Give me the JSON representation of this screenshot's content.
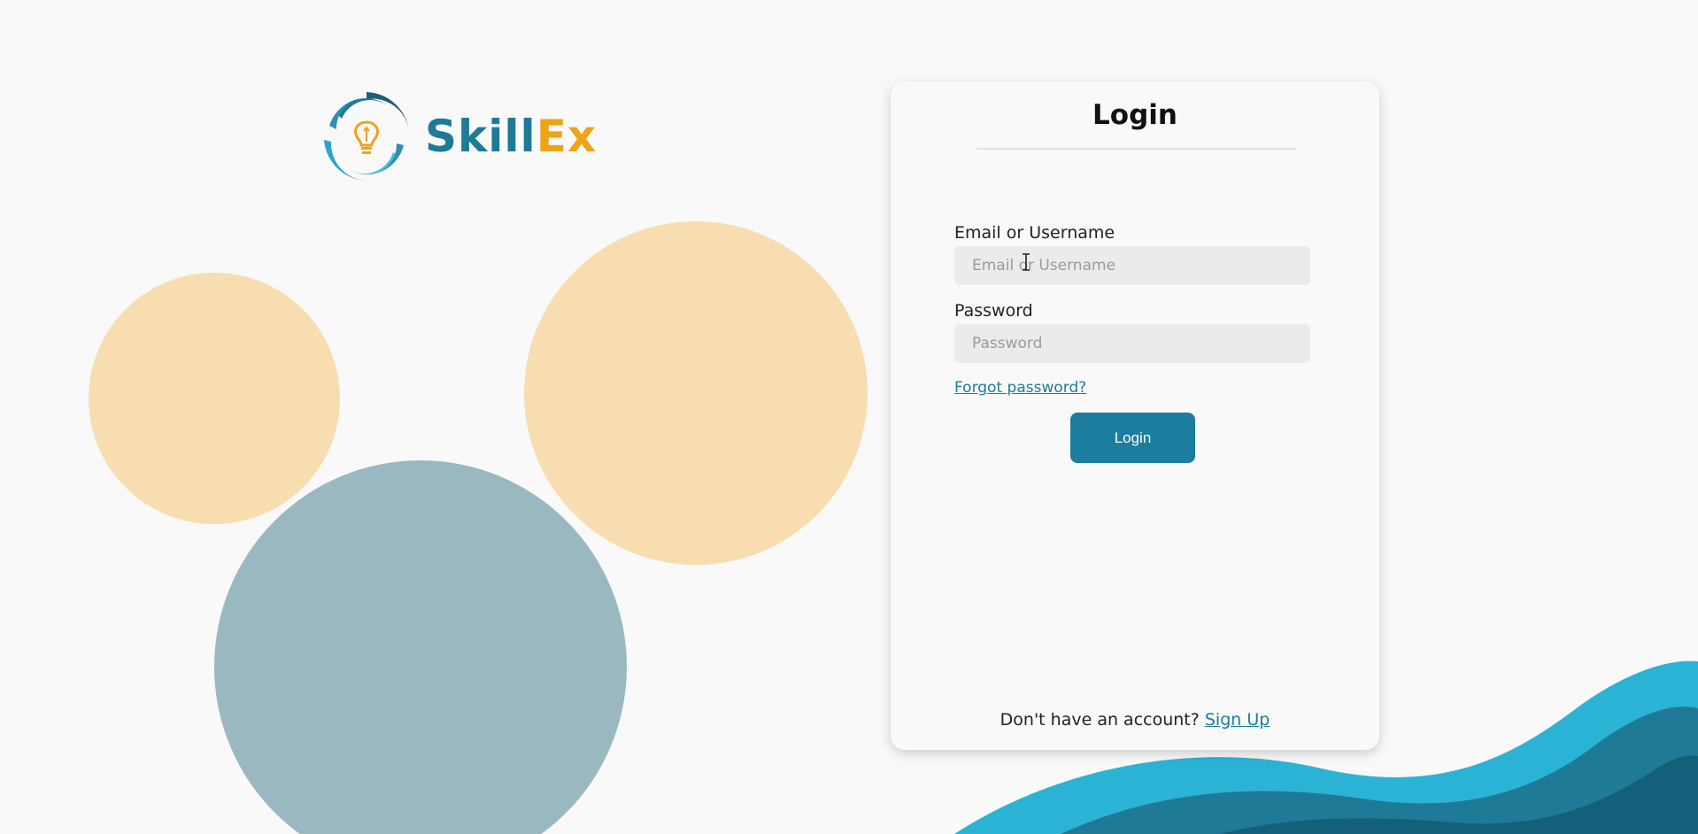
{
  "brand": {
    "name_part1": "Skill",
    "name_part2": "Ex",
    "colors": {
      "primary": "#1f7a98",
      "accent": "#f0a218"
    }
  },
  "login": {
    "title": "Login",
    "email_label": "Email or Username",
    "email_placeholder": "Email or Username",
    "password_label": "Password",
    "password_placeholder": "Password",
    "forgot_password": "Forgot password?",
    "submit_label": "Login",
    "signup_prompt": "Don't have an account?",
    "signup_link": "Sign Up"
  },
  "icons": {
    "logo": "lightbulb-swirl-icon",
    "cursor": "text-cursor-icon"
  },
  "colors": {
    "button": "#1c7d9e",
    "circle_orange": "#f8ddb0",
    "circle_teal": "#9ab8c0",
    "wave_light": "#2bb3d6",
    "wave_mid": "#1f7a98",
    "wave_dark": "#145f7a"
  }
}
